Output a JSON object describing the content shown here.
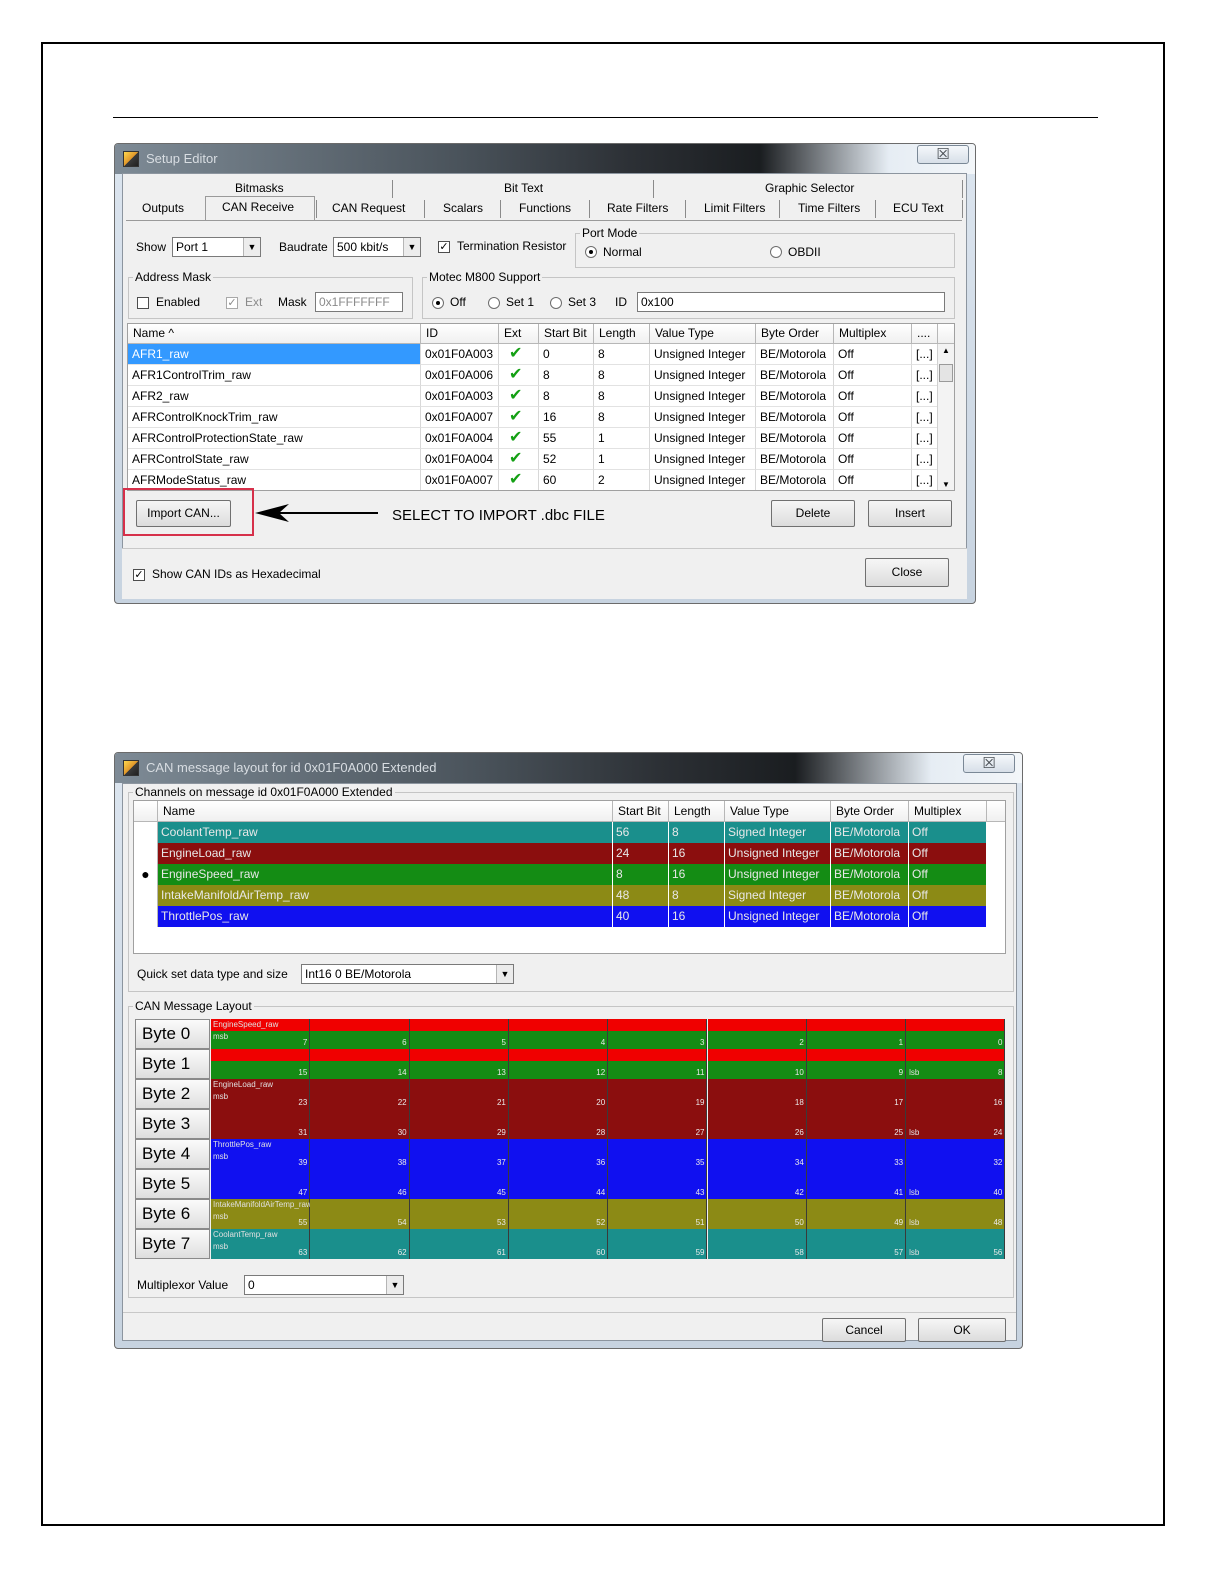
{
  "setup_editor": {
    "title": "Setup Editor",
    "close_glyph": "☒",
    "tabs_row1": [
      "Bitmasks",
      "Bit Text",
      "Graphic Selector"
    ],
    "tabs_row2": [
      "Outputs",
      "CAN Receive",
      "CAN Request",
      "Scalars",
      "Functions",
      "Rate Filters",
      "Limit Filters",
      "Time Filters",
      "ECU Text"
    ],
    "show_label": "Show",
    "show_value": "Port 1",
    "baudrate_label": "Baudrate",
    "baudrate_value": "500 kbit/s",
    "termination_label": "Termination Resistor",
    "port_mode": {
      "title": "Port Mode",
      "normal": "Normal",
      "obdii": "OBDII"
    },
    "address_mask": {
      "title": "Address Mask",
      "enabled": "Enabled",
      "ext": "Ext",
      "mask_label": "Mask",
      "mask_value": "0x1FFFFFFF"
    },
    "motec": {
      "title": "Motec M800 Support",
      "off": "Off",
      "set1": "Set 1",
      "set3": "Set 3",
      "id_label": "ID",
      "id_value": "0x100"
    },
    "columns": [
      "Name ^",
      "ID",
      "Ext",
      "Start Bit",
      "Length",
      "Value Type",
      "Byte Order",
      "Multiplex",
      "...."
    ],
    "rows": [
      {
        "name": "AFR1_raw",
        "id": "0x01F0A003",
        "start": "0",
        "length": "8",
        "type": "Unsigned Integer",
        "order": "BE/Motorola",
        "mux": "Off",
        "more": "[...]"
      },
      {
        "name": "AFR1ControlTrim_raw",
        "id": "0x01F0A006",
        "start": "8",
        "length": "8",
        "type": "Unsigned Integer",
        "order": "BE/Motorola",
        "mux": "Off",
        "more": "[...]"
      },
      {
        "name": "AFR2_raw",
        "id": "0x01F0A003",
        "start": "8",
        "length": "8",
        "type": "Unsigned Integer",
        "order": "BE/Motorola",
        "mux": "Off",
        "more": "[...]"
      },
      {
        "name": "AFRControlKnockTrim_raw",
        "id": "0x01F0A007",
        "start": "16",
        "length": "8",
        "type": "Unsigned Integer",
        "order": "BE/Motorola",
        "mux": "Off",
        "more": "[...]"
      },
      {
        "name": "AFRControlProtectionState_raw",
        "id": "0x01F0A004",
        "start": "55",
        "length": "1",
        "type": "Unsigned Integer",
        "order": "BE/Motorola",
        "mux": "Off",
        "more": "[...]"
      },
      {
        "name": "AFRControlState_raw",
        "id": "0x01F0A004",
        "start": "52",
        "length": "1",
        "type": "Unsigned Integer",
        "order": "BE/Motorola",
        "mux": "Off",
        "more": "[...]"
      },
      {
        "name": "AFRModeStatus_raw",
        "id": "0x01F0A007",
        "start": "60",
        "length": "2",
        "type": "Unsigned Integer",
        "order": "BE/Motorola",
        "mux": "Off",
        "more": "[...]"
      }
    ],
    "import_label": "Import CAN...",
    "annotation": "SELECT TO IMPORT .dbc FILE",
    "delete_label": "Delete",
    "insert_label": "Insert",
    "hex_label": "Show CAN IDs as Hexadecimal",
    "close_label": "Close"
  },
  "can_layout": {
    "title": "CAN message layout for id 0x01F0A000 Extended",
    "close_glyph": "☒",
    "channels_title": "Channels on message id 0x01F0A000 Extended",
    "columns": [
      "Name",
      "Start Bit",
      "Length",
      "Value Type",
      "Byte Order",
      "Multiplex"
    ],
    "rows": [
      {
        "name": "CoolantTemp_raw",
        "start": "56",
        "length": "8",
        "type": "Signed Integer",
        "order": "BE/Motorola",
        "mux": "Off",
        "color": "#1a8f8c",
        "marker": ""
      },
      {
        "name": "EngineLoad_raw",
        "start": "24",
        "length": "16",
        "type": "Unsigned Integer",
        "order": "BE/Motorola",
        "mux": "Off",
        "color": "#8b0e0e",
        "marker": ""
      },
      {
        "name": "EngineSpeed_raw",
        "start": "8",
        "length": "16",
        "type": "Unsigned Integer",
        "order": "BE/Motorola",
        "mux": "Off",
        "color": "#148c14",
        "marker": "●"
      },
      {
        "name": "IntakeManifoldAirTemp_raw",
        "start": "48",
        "length": "8",
        "type": "Signed Integer",
        "order": "BE/Motorola",
        "mux": "Off",
        "color": "#8c8a15",
        "marker": ""
      },
      {
        "name": "ThrottlePos_raw",
        "start": "40",
        "length": "16",
        "type": "Unsigned Integer",
        "order": "BE/Motorola",
        "mux": "Off",
        "color": "#1010f0",
        "marker": ""
      }
    ],
    "quickset_label": "Quick set data type and size",
    "quickset_value": "Int16 0 BE/Motorola",
    "layout_title": "CAN Message Layout",
    "bytes": [
      {
        "label": "Byte 0",
        "color": "#148c14",
        "top_band": "#f00000",
        "signal": "EngineSpeed_raw",
        "msb": "msb",
        "lsb": "",
        "bits": [
          "7",
          "6",
          "5",
          "4",
          "3",
          "2",
          "1",
          "0"
        ]
      },
      {
        "label": "Byte 1",
        "color": "#148c14",
        "top_band": "#f00000",
        "signal": "",
        "msb": "",
        "lsb": "lsb",
        "bits": [
          "15",
          "14",
          "13",
          "12",
          "11",
          "10",
          "9",
          "8"
        ]
      },
      {
        "label": "Byte 2",
        "color": "#8b0e0e",
        "top_band": "",
        "signal": "EngineLoad_raw",
        "msb": "msb",
        "lsb": "",
        "bits": [
          "23",
          "22",
          "21",
          "20",
          "19",
          "18",
          "17",
          "16"
        ]
      },
      {
        "label": "Byte 3",
        "color": "#8b0e0e",
        "top_band": "",
        "signal": "",
        "msb": "",
        "lsb": "lsb",
        "bits": [
          "31",
          "30",
          "29",
          "28",
          "27",
          "26",
          "25",
          "24"
        ]
      },
      {
        "label": "Byte 4",
        "color": "#1010f0",
        "top_band": "",
        "signal": "ThrottlePos_raw",
        "msb": "msb",
        "lsb": "",
        "bits": [
          "39",
          "38",
          "37",
          "36",
          "35",
          "34",
          "33",
          "32"
        ]
      },
      {
        "label": "Byte 5",
        "color": "#1010f0",
        "top_band": "",
        "signal": "",
        "msb": "",
        "lsb": "lsb",
        "bits": [
          "47",
          "46",
          "45",
          "44",
          "43",
          "42",
          "41",
          "40"
        ]
      },
      {
        "label": "Byte 6",
        "color": "#8c8a15",
        "top_band": "",
        "signal": "IntakeManifoldAirTemp_raw",
        "msb": "msb",
        "lsb": "lsb",
        "bits": [
          "55",
          "54",
          "53",
          "52",
          "51",
          "50",
          "49",
          "48"
        ]
      },
      {
        "label": "Byte 7",
        "color": "#1a8f8c",
        "top_band": "",
        "signal": "CoolantTemp_raw",
        "msb": "msb",
        "lsb": "lsb",
        "bits": [
          "63",
          "62",
          "61",
          "60",
          "59",
          "58",
          "57",
          "56"
        ]
      }
    ],
    "multiplexor_label": "Multiplexor Value",
    "multiplexor_value": "0",
    "cancel_label": "Cancel",
    "ok_label": "OK"
  }
}
